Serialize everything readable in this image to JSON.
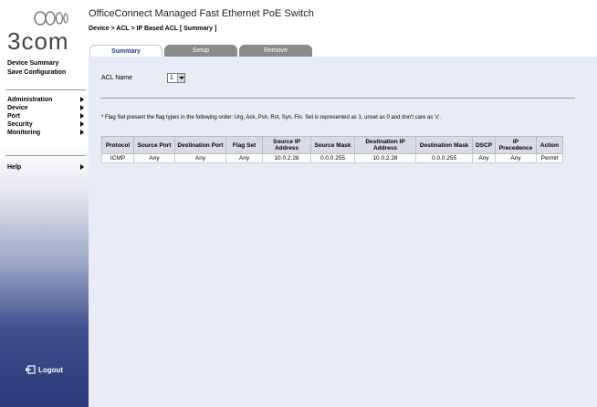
{
  "header": {
    "title": "OfficeConnect Managed Fast Ethernet PoE Switch",
    "breadcrumb": "Device > ACL > IP Based ACL [ Summary ]"
  },
  "logo": {
    "text": "3com"
  },
  "sidebar": {
    "top_links": [
      "Device Summary",
      "Save Configuration"
    ],
    "menu": [
      {
        "label": "Administration"
      },
      {
        "label": "Device"
      },
      {
        "label": "Port"
      },
      {
        "label": "Security"
      },
      {
        "label": "Monitoring"
      }
    ],
    "help": "Help",
    "logout": "Logout"
  },
  "tabs": [
    {
      "label": "Summary",
      "active": true
    },
    {
      "label": "Setup",
      "active": false
    },
    {
      "label": "Remove",
      "active": false
    }
  ],
  "form": {
    "acl_name_label": "ACL Name",
    "acl_name_value": "1"
  },
  "note": "* Flag Set present the flag types in the following order: Urg, Ack, Psh, Rst, Syn, Fin. Set is represented as 1, unset as 0 and don't care as 'x'.",
  "table": {
    "headers": [
      "Protocol",
      "Source Port",
      "Destination Port",
      "Flag Set",
      "Source IP Address",
      "Source Mask",
      "Destination IP Address",
      "Destination Mask",
      "DSCP",
      "IP Precedence",
      "Action"
    ],
    "rows": [
      [
        "ICMP",
        "Any",
        "Any",
        "Any",
        "10.0.2.28",
        "0.0.0.255",
        "10.0.2.28",
        "0.0.0.255",
        "Any",
        "Any",
        "Permit"
      ]
    ]
  },
  "colors": {
    "content_bg": "#e8ecf6",
    "tab_inactive": "#8b8b8b",
    "tab_active_text": "#1a3d8c",
    "sidebar_dark": "#2a3a7a"
  }
}
